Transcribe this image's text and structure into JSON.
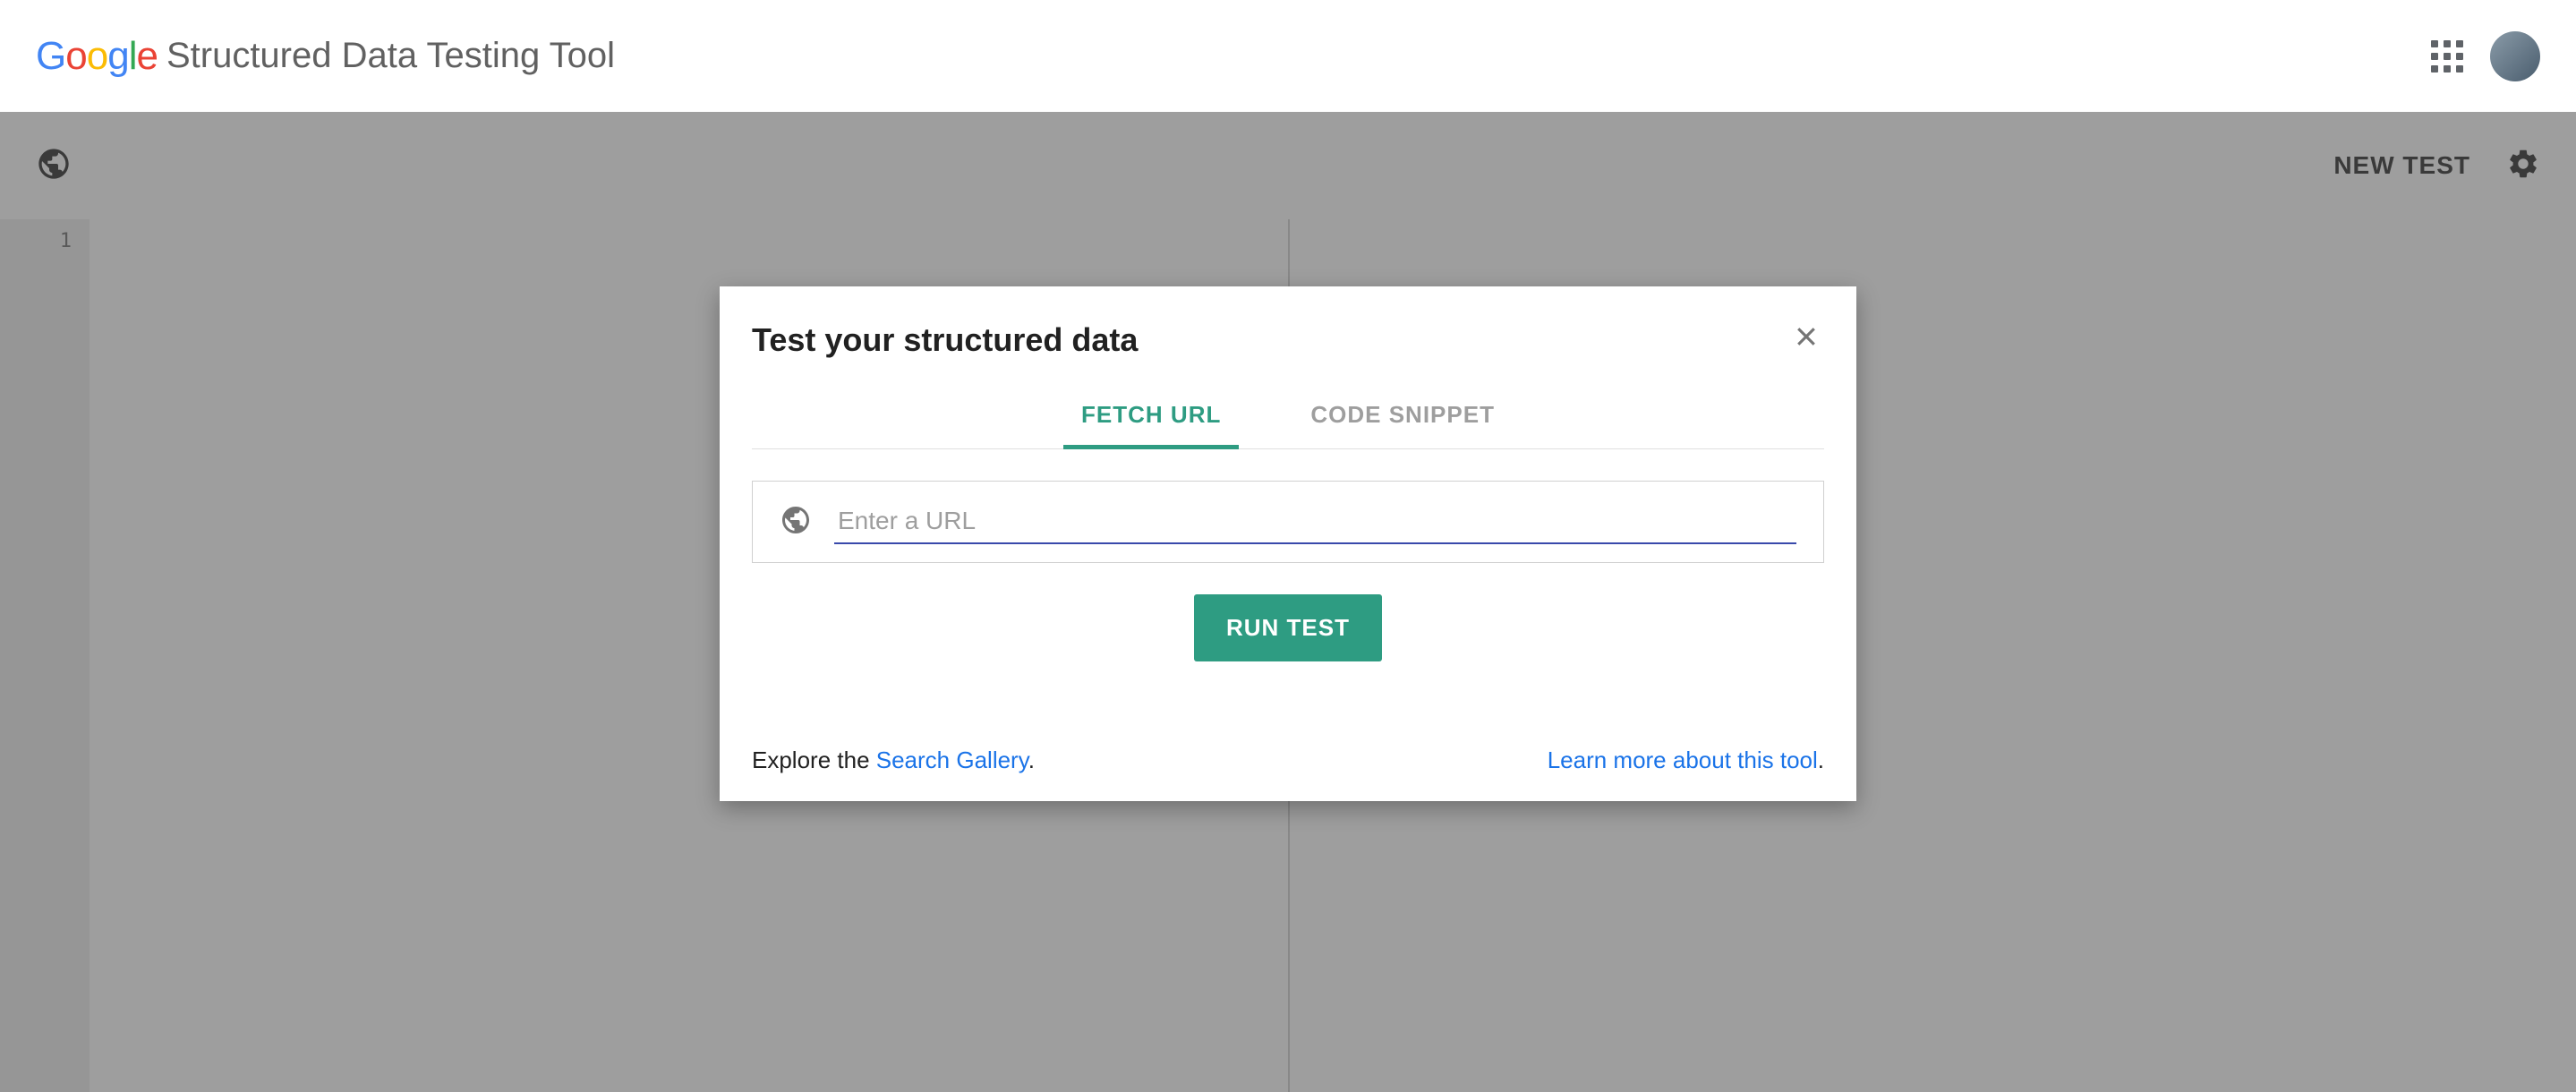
{
  "header": {
    "app_title": "Structured Data Testing Tool"
  },
  "toolbar": {
    "new_test_label": "NEW TEST"
  },
  "editor": {
    "line_number": "1"
  },
  "modal": {
    "title": "Test your structured data",
    "tabs": {
      "fetch_url": "FETCH URL",
      "code_snippet": "CODE SNIPPET"
    },
    "url_placeholder": "Enter a URL",
    "url_value": "",
    "run_button": "RUN TEST",
    "footer": {
      "explore_prefix": "Explore the ",
      "search_gallery": "Search Gallery",
      "explore_suffix": ".",
      "learn_more": "Learn more about this tool",
      "learn_more_suffix": "."
    }
  }
}
